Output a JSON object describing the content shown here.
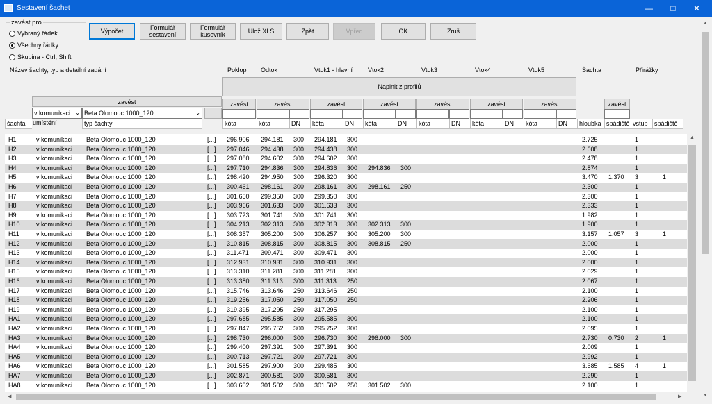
{
  "window": {
    "title": "Sestavení šachet"
  },
  "group": {
    "legend": "zavést pro",
    "options": [
      "Vybraný řádek",
      "Všechny řádky",
      "Skupina - Ctrl, Shift"
    ],
    "selected": 1
  },
  "toolbar": {
    "vypocet": "Výpočet",
    "formular_sestaveni": "Formulář sestavení",
    "formular_kusovnik": "Formulář kusovník",
    "uloz_xls": "Ulož XLS",
    "zpet": "Zpět",
    "vpred": "Vpřed",
    "ok": "OK",
    "zrus": "Zruš"
  },
  "headers": {
    "nazev": "Název šachty, typ a detailní zadání",
    "poklop": "Poklop",
    "odtok": "Odtok",
    "vtok1": "Vtok1 - hlavní",
    "vtok2": "Vtok2",
    "vtok3": "Vtok3",
    "vtok4": "Vtok4",
    "vtok5": "Vtok5",
    "sachta": "Šachta",
    "prirazky": "Přirážky",
    "naplnit": "Naplnit z profilů",
    "zavest": "zavést",
    "umisteni_combo": "v komunikaci",
    "typ_combo": "Beta Olomouc 1000_120",
    "ellipsis": "...",
    "umisteni": "umístění",
    "cols": [
      "šachta",
      "typ šachty",
      "kóta",
      "kóta",
      "DN",
      "kóta",
      "DN",
      "kóta",
      "DN",
      "kóta",
      "DN",
      "kóta",
      "DN",
      "kóta",
      "DN",
      "hloubka",
      "spádiště",
      "vstup",
      "spádiště"
    ]
  },
  "rows": [
    [
      "H1",
      "v komunikaci",
      "Beta Olomouc 1000_120",
      "[...]",
      "296.906",
      "294.181",
      "300",
      "294.181",
      "300",
      "",
      "",
      "2.725",
      "",
      "1",
      ""
    ],
    [
      "H2",
      "v komunikaci",
      "Beta Olomouc 1000_120",
      "[...]",
      "297.046",
      "294.438",
      "300",
      "294.438",
      "300",
      "",
      "",
      "2.608",
      "",
      "1",
      ""
    ],
    [
      "H3",
      "v komunikaci",
      "Beta Olomouc 1000_120",
      "[...]",
      "297.080",
      "294.602",
      "300",
      "294.602",
      "300",
      "",
      "",
      "2.478",
      "",
      "1",
      ""
    ],
    [
      "H4",
      "v komunikaci",
      "Beta Olomouc 1000_120",
      "[...]",
      "297.710",
      "294.836",
      "300",
      "294.836",
      "300",
      "294.836",
      "300",
      "2.874",
      "",
      "1",
      ""
    ],
    [
      "H5",
      "v komunikaci",
      "Beta Olomouc 1000_120",
      "[...]",
      "298.420",
      "294.950",
      "300",
      "296.320",
      "300",
      "",
      "",
      "3.470",
      "1.370",
      "3",
      "1"
    ],
    [
      "H6",
      "v komunikaci",
      "Beta Olomouc 1000_120",
      "[...]",
      "300.461",
      "298.161",
      "300",
      "298.161",
      "300",
      "298.161",
      "250",
      "2.300",
      "",
      "1",
      ""
    ],
    [
      "H7",
      "v komunikaci",
      "Beta Olomouc 1000_120",
      "[...]",
      "301.650",
      "299.350",
      "300",
      "299.350",
      "300",
      "",
      "",
      "2.300",
      "",
      "1",
      ""
    ],
    [
      "H8",
      "v komunikaci",
      "Beta Olomouc 1000_120",
      "[...]",
      "303.966",
      "301.633",
      "300",
      "301.633",
      "300",
      "",
      "",
      "2.333",
      "",
      "1",
      ""
    ],
    [
      "H9",
      "v komunikaci",
      "Beta Olomouc 1000_120",
      "[...]",
      "303.723",
      "301.741",
      "300",
      "301.741",
      "300",
      "",
      "",
      "1.982",
      "",
      "1",
      ""
    ],
    [
      "H10",
      "v komunikaci",
      "Beta Olomouc 1000_120",
      "[...]",
      "304.213",
      "302.313",
      "300",
      "302.313",
      "300",
      "302.313",
      "300",
      "1.900",
      "",
      "1",
      ""
    ],
    [
      "H11",
      "v komunikaci",
      "Beta Olomouc 1000_120",
      "[...]",
      "308.357",
      "305.200",
      "300",
      "306.257",
      "300",
      "305.200",
      "300",
      "3.157",
      "1.057",
      "3",
      "1"
    ],
    [
      "H12",
      "v komunikaci",
      "Beta Olomouc 1000_120",
      "[...]",
      "310.815",
      "308.815",
      "300",
      "308.815",
      "300",
      "308.815",
      "250",
      "2.000",
      "",
      "1",
      ""
    ],
    [
      "H13",
      "v komunikaci",
      "Beta Olomouc 1000_120",
      "[...]",
      "311.471",
      "309.471",
      "300",
      "309.471",
      "300",
      "",
      "",
      "2.000",
      "",
      "1",
      ""
    ],
    [
      "H14",
      "v komunikaci",
      "Beta Olomouc 1000_120",
      "[...]",
      "312.931",
      "310.931",
      "300",
      "310.931",
      "300",
      "",
      "",
      "2.000",
      "",
      "1",
      ""
    ],
    [
      "H15",
      "v komunikaci",
      "Beta Olomouc 1000_120",
      "[...]",
      "313.310",
      "311.281",
      "300",
      "311.281",
      "300",
      "",
      "",
      "2.029",
      "",
      "1",
      ""
    ],
    [
      "H16",
      "v komunikaci",
      "Beta Olomouc 1000_120",
      "[...]",
      "313.380",
      "311.313",
      "300",
      "311.313",
      "250",
      "",
      "",
      "2.067",
      "",
      "1",
      ""
    ],
    [
      "H17",
      "v komunikaci",
      "Beta Olomouc 1000_120",
      "[...]",
      "315.746",
      "313.646",
      "250",
      "313.646",
      "250",
      "",
      "",
      "2.100",
      "",
      "1",
      ""
    ],
    [
      "H18",
      "v komunikaci",
      "Beta Olomouc 1000_120",
      "[...]",
      "319.256",
      "317.050",
      "250",
      "317.050",
      "250",
      "",
      "",
      "2.206",
      "",
      "1",
      ""
    ],
    [
      "H19",
      "v komunikaci",
      "Beta Olomouc 1000_120",
      "[...]",
      "319.395",
      "317.295",
      "250",
      "317.295",
      "",
      "",
      "",
      "2.100",
      "",
      "1",
      ""
    ],
    [
      "HA1",
      "v komunikaci",
      "Beta Olomouc 1000_120",
      "[...]",
      "297.685",
      "295.585",
      "300",
      "295.585",
      "300",
      "",
      "",
      "2.100",
      "",
      "1",
      ""
    ],
    [
      "HA2",
      "v komunikaci",
      "Beta Olomouc 1000_120",
      "[...]",
      "297.847",
      "295.752",
      "300",
      "295.752",
      "300",
      "",
      "",
      "2.095",
      "",
      "1",
      ""
    ],
    [
      "HA3",
      "v komunikaci",
      "Beta Olomouc 1000_120",
      "[...]",
      "298.730",
      "296.000",
      "300",
      "296.730",
      "300",
      "296.000",
      "300",
      "2.730",
      "0.730",
      "2",
      "1"
    ],
    [
      "HA4",
      "v komunikaci",
      "Beta Olomouc 1000_120",
      "[...]",
      "299.400",
      "297.391",
      "300",
      "297.391",
      "300",
      "",
      "",
      "2.009",
      "",
      "1",
      ""
    ],
    [
      "HA5",
      "v komunikaci",
      "Beta Olomouc 1000_120",
      "[...]",
      "300.713",
      "297.721",
      "300",
      "297.721",
      "300",
      "",
      "",
      "2.992",
      "",
      "1",
      ""
    ],
    [
      "HA6",
      "v komunikaci",
      "Beta Olomouc 1000_120",
      "[...]",
      "301.585",
      "297.900",
      "300",
      "299.485",
      "300",
      "",
      "",
      "3.685",
      "1.585",
      "4",
      "1"
    ],
    [
      "HA7",
      "v komunikaci",
      "Beta Olomouc 1000_120",
      "[...]",
      "302.871",
      "300.581",
      "300",
      "300.581",
      "300",
      "",
      "",
      "2.290",
      "",
      "1",
      ""
    ],
    [
      "HA8",
      "v komunikaci",
      "Beta Olomouc 1000_120",
      "[...]",
      "303.602",
      "301.502",
      "300",
      "301.502",
      "250",
      "301.502",
      "300",
      "2.100",
      "",
      "1",
      ""
    ]
  ]
}
